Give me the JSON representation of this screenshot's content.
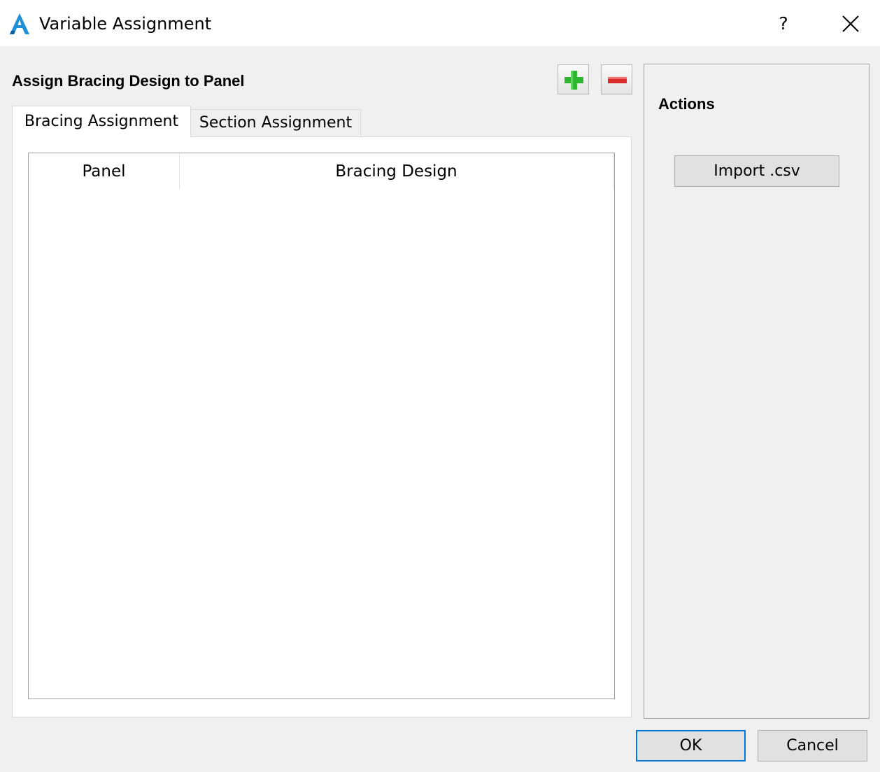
{
  "window": {
    "title": "Variable Assignment",
    "help_label": "?",
    "icons": {
      "app": "app-logo-icon",
      "close": "close-icon"
    }
  },
  "main": {
    "section_title": "Assign Bracing Design to Panel",
    "toolbar": {
      "add_icon": "plus-icon",
      "remove_icon": "minus-icon"
    },
    "tabs": [
      {
        "label": "Bracing Assignment",
        "active": true
      },
      {
        "label": "Section Assignment",
        "active": false
      }
    ],
    "table": {
      "columns": [
        "Panel",
        "Bracing Design"
      ],
      "rows": []
    }
  },
  "actions": {
    "title": "Actions",
    "import_label": "Import .csv"
  },
  "footer": {
    "ok_label": "OK",
    "cancel_label": "Cancel"
  },
  "colors": {
    "accent": "#0078d7",
    "add_green": "#2fb62f",
    "remove_red": "#d92a2a",
    "app_icon_blue": "#1f8fd8"
  }
}
